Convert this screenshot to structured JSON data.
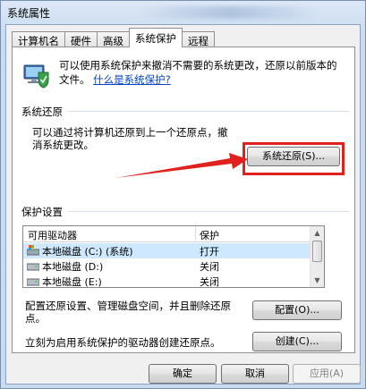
{
  "window": {
    "title": "系统属性"
  },
  "tabs": [
    "计算机名",
    "硬件",
    "高级",
    "系统保护",
    "远程"
  ],
  "active_tab": "系统保护",
  "intro": {
    "text": "可以使用系统保护来撤消不需要的系统更改，还原以前版本的文件。",
    "link": "什么是系统保护?"
  },
  "restore": {
    "group_label": "系统还原",
    "description": "可以通过将计算机还原到上一个还原点，撤消系统更改。",
    "button": "系统还原(S)..."
  },
  "protection": {
    "group_label": "保护设置",
    "columns": [
      "可用驱动器",
      "保护"
    ],
    "rows": [
      {
        "drive": "本地磁盘 (C:) (系统)",
        "status": "打开",
        "selected": true
      },
      {
        "drive": "本地磁盘 (D:)",
        "status": "关闭",
        "selected": false
      },
      {
        "drive": "本地磁盘 (E:)",
        "status": "关闭",
        "selected": false
      }
    ],
    "configure_text": "配置还原设置、管理磁盘空间，并且删除还原点。",
    "configure_button": "配置(O)...",
    "create_text": "立刻为启用系统保护的驱动器创建还原点。",
    "create_button": "创建(C)..."
  },
  "footer": {
    "ok": "确定",
    "cancel": "取消",
    "apply": "应用(A)"
  },
  "colors": {
    "highlight": "#e0211d",
    "link": "#0645c8"
  }
}
